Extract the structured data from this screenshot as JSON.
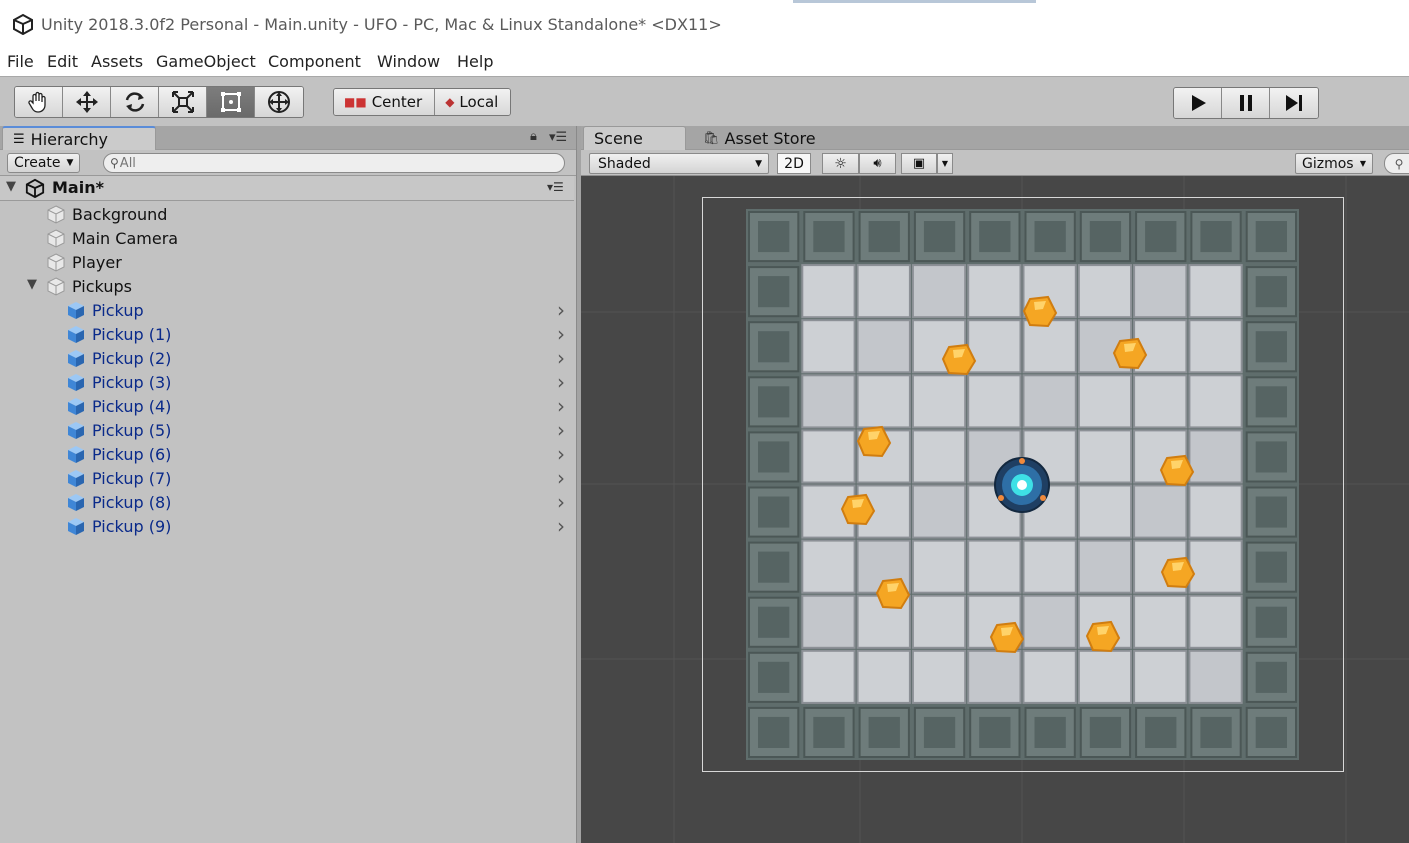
{
  "window": {
    "title": "Unity 2018.3.0f2 Personal - Main.unity - UFO - PC, Mac & Linux Standalone* <DX11>"
  },
  "menu": [
    "File",
    "Edit",
    "Assets",
    "GameObject",
    "Component",
    "Window",
    "Help"
  ],
  "toolbar": {
    "tools": [
      "hand-tool-icon",
      "move-tool-icon",
      "rotate-tool-icon",
      "scale-tool-icon",
      "rect-tool-icon",
      "transform-tool-icon"
    ],
    "active_tool": "rect-tool-icon",
    "pivot_label": "Center",
    "space_label": "Local",
    "playback": [
      "play-icon",
      "pause-icon",
      "step-icon"
    ]
  },
  "hierarchy": {
    "tab_label": "Hierarchy",
    "create_label": "Create",
    "search_placeholder": "All",
    "scene_name": "Main*",
    "objects": [
      "Background",
      "Main Camera",
      "Player",
      "Pickups"
    ],
    "pickups": [
      "Pickup",
      "Pickup (1)",
      "Pickup (2)",
      "Pickup (3)",
      "Pickup (4)",
      "Pickup (5)",
      "Pickup (6)",
      "Pickup (7)",
      "Pickup (8)",
      "Pickup (9)"
    ]
  },
  "scene_view": {
    "tabs": [
      "Scene",
      "Asset Store"
    ],
    "shading_mode": "Shaded",
    "mode_2d_label": "2D",
    "gizmos_label": "Gizmos",
    "colors": {
      "viewport_bg": "#474747",
      "floor_tile": "#cdd0d4",
      "wall": "#5f6d6c",
      "pickup": "#f5a623",
      "player": "#2e6fa6"
    }
  }
}
